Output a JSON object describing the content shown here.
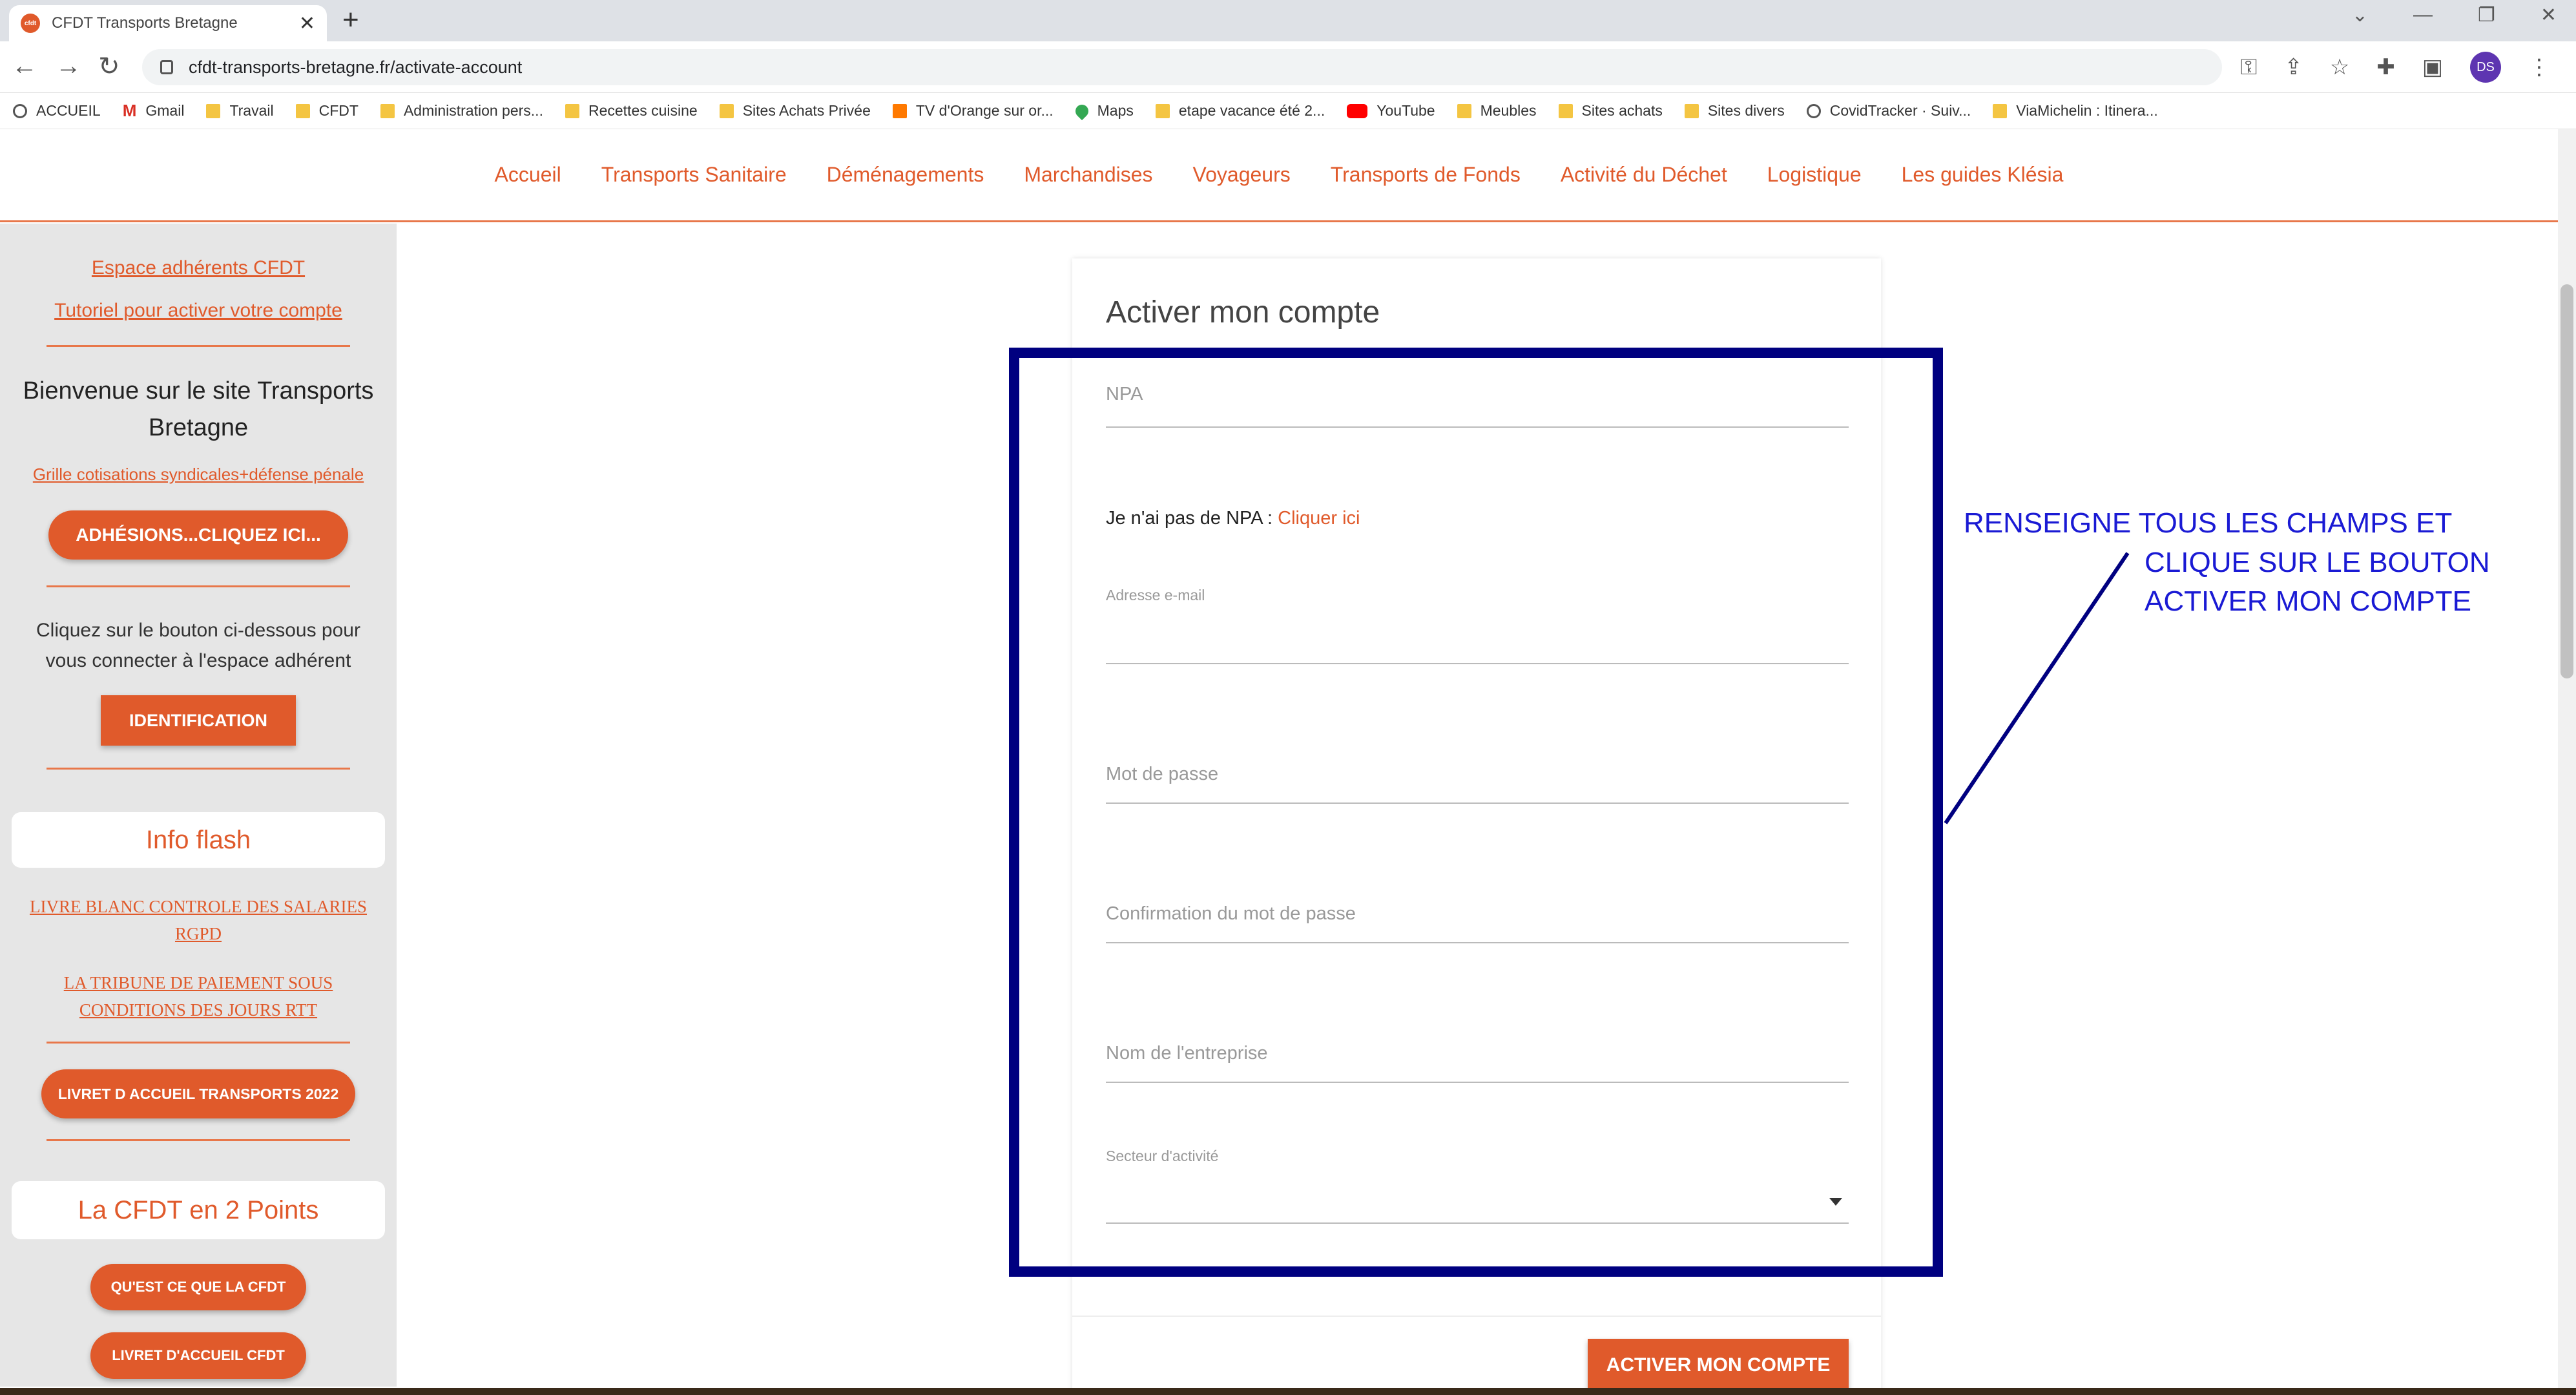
{
  "browser": {
    "tab_title": "CFDT Transports Bretagne",
    "tab_favicon_text": "cfdt",
    "url": "cfdt-transports-bretagne.fr/activate-account",
    "avatar_initials": "DS",
    "bookmarks": [
      {
        "label": "ACCUEIL",
        "icon": "globe-icon"
      },
      {
        "label": "Gmail",
        "icon": "gmail-icon"
      },
      {
        "label": "Travail",
        "icon": "folder-icon"
      },
      {
        "label": "CFDT",
        "icon": "folder-icon"
      },
      {
        "label": "Administration pers...",
        "icon": "folder-icon"
      },
      {
        "label": "Recettes cuisine",
        "icon": "folder-icon"
      },
      {
        "label": "Sites Achats Privée",
        "icon": "folder-icon"
      },
      {
        "label": "TV d'Orange sur or...",
        "icon": "tv-icon"
      },
      {
        "label": "Maps",
        "icon": "maps-icon"
      },
      {
        "label": "etape vacance été 2...",
        "icon": "folder-icon"
      },
      {
        "label": "YouTube",
        "icon": "youtube-icon"
      },
      {
        "label": "Meubles",
        "icon": "folder-icon"
      },
      {
        "label": "Sites achats",
        "icon": "folder-icon"
      },
      {
        "label": "Sites divers",
        "icon": "folder-icon"
      },
      {
        "label": "CovidTracker · Suiv...",
        "icon": "globe-icon"
      },
      {
        "label": "ViaMichelin : Itinera...",
        "icon": "folder-icon"
      }
    ]
  },
  "site_nav": [
    "Accueil",
    "Transports Sanitaire",
    "Déménagements",
    "Marchandises",
    "Voyageurs",
    "Transports de Fonds",
    "Activité du Déchet",
    "Logistique",
    "Les guides Klésia"
  ],
  "sidebar": {
    "link_espace": "Espace adhérents CFDT",
    "link_tutoriel": "Tutoriel pour activer votre compte",
    "welcome": "Bienvenue sur le site Transports Bretagne",
    "link_grille": "Grille cotisations syndicales+défense pénale",
    "btn_adhesions": "ADHÉSIONS...CLIQUEZ ICI...",
    "connect_text": "Cliquez sur le bouton ci-dessous pour vous connecter à l'espace adhérent",
    "btn_identification": "IDENTIFICATION",
    "info_flash_title": "Info flash",
    "link_livre_blanc": "LIVRE BLANC CONTROLE DES SALARIES RGPD",
    "link_tribune": "LA TRIBUNE DE PAIEMENT SOUS CONDITIONS DES JOURS RTT",
    "btn_livret_transports": "LIVRET D ACCUEIL TRANSPORTS 2022",
    "cfdt_2_points_title": "La CFDT en 2 Points",
    "btn_quest_ce": "QU'EST CE QUE LA CFDT",
    "btn_livret_cfdt": "LIVRET D'ACCUEIL CFDT"
  },
  "form": {
    "title": "Activer mon compte",
    "npa_placeholder": "NPA",
    "no_npa_text": "Je n'ai pas de NPA : ",
    "no_npa_link": "Cliquer ici",
    "email_label": "Adresse e-mail",
    "password_placeholder": "Mot de passe",
    "confirm_placeholder": "Confirmation du mot de passe",
    "company_placeholder": "Nom de l'entreprise",
    "sector_label": "Secteur d'activité",
    "submit": "ACTIVER MON COMPTE"
  },
  "annotation": {
    "line1": "RENSEIGNE TOUS LES CHAMPS ET",
    "line2": "CLIQUE SUR LE BOUTON",
    "line3": "ACTIVER MON COMPTE",
    "color": "#000080"
  },
  "colors": {
    "accent": "#e05a2b",
    "annotation_text": "#1a1ad4"
  }
}
